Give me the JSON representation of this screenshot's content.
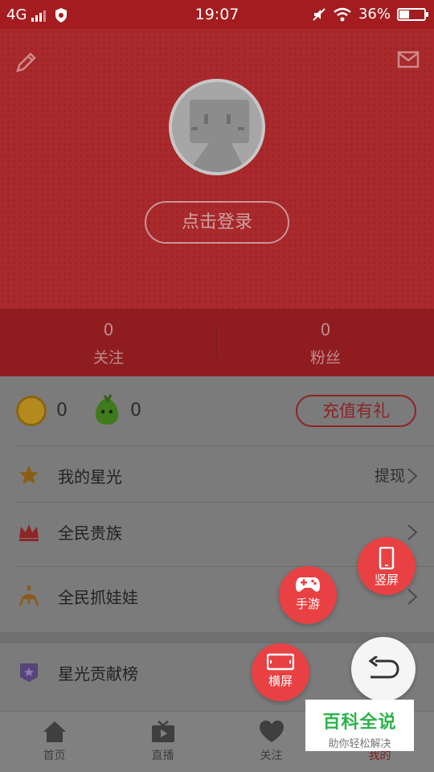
{
  "status_bar": {
    "network": "4G",
    "time": "19:07",
    "battery": "36%",
    "battery_level": 0.36
  },
  "header": {
    "login_label": "点击登录",
    "stats": [
      {
        "value": "0",
        "label": "关注"
      },
      {
        "value": "0",
        "label": "粉丝"
      }
    ]
  },
  "wallet": {
    "coins": "0",
    "beans": "0",
    "recharge_label": "充值有礼"
  },
  "menu": [
    {
      "label": "我的星光",
      "right": "提现"
    },
    {
      "label": "全民贵族",
      "right": ""
    },
    {
      "label": "全民抓娃娃",
      "right": ""
    },
    {
      "label": "星光贡献榜",
      "right": ""
    }
  ],
  "floating": {
    "portrait_label": "竖屏",
    "game_label": "手游",
    "landscape_label": "横屏"
  },
  "bottom_nav": [
    {
      "label": "首页"
    },
    {
      "label": "直播"
    },
    {
      "label": "关注"
    },
    {
      "label": "我的"
    }
  ],
  "watermark": {
    "title": "百科全说",
    "subtitle": "助你轻松解决"
  },
  "colors": {
    "header_red": "#a9292c",
    "fab_red": "#e94143",
    "watermark_green": "#2cb34a"
  }
}
